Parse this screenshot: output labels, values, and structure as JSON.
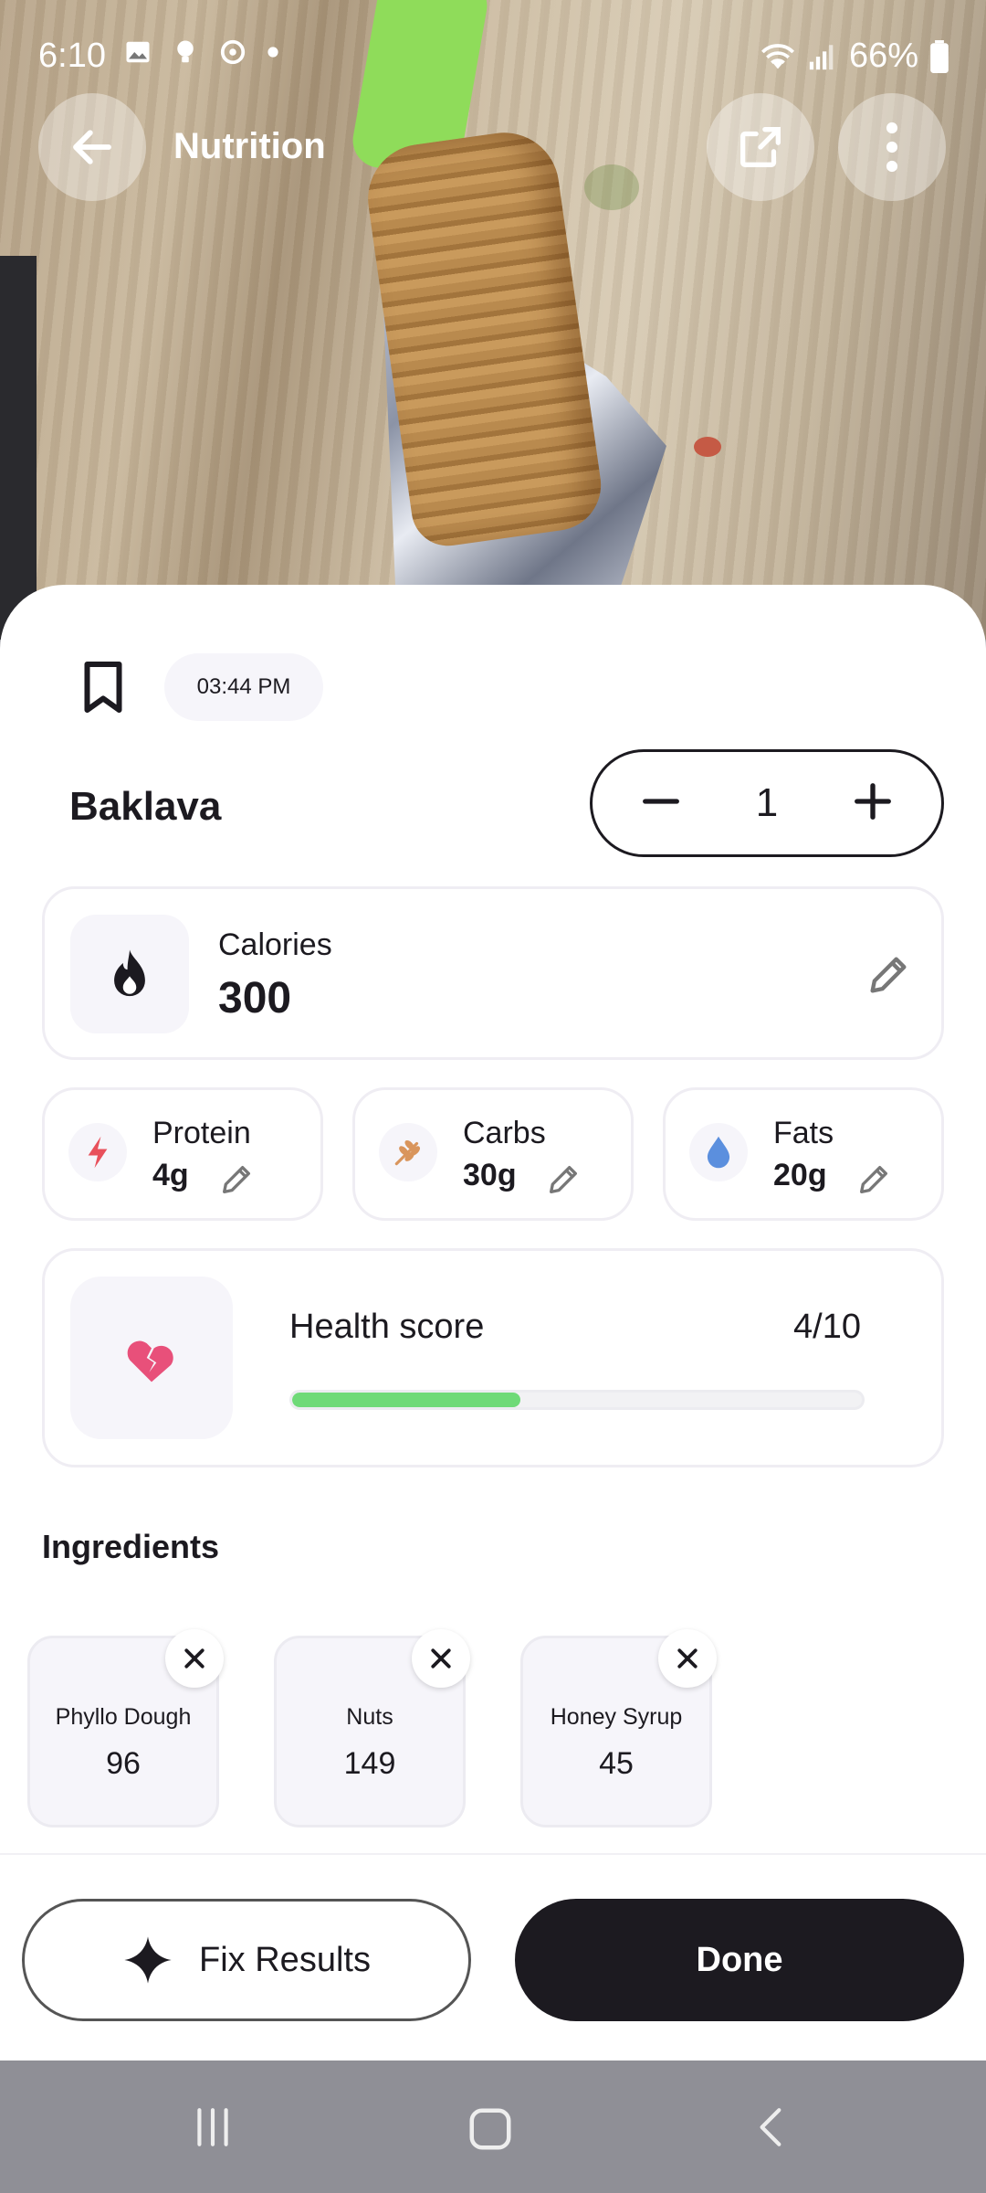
{
  "status_bar": {
    "time": "6:10",
    "battery": "66%"
  },
  "app_bar": {
    "title": "Nutrition"
  },
  "entry": {
    "timestamp": "03:44 PM",
    "food_name": "Baklava",
    "quantity": "1"
  },
  "calories": {
    "label": "Calories",
    "value": "300"
  },
  "macros": [
    {
      "label": "Protein",
      "value": "4g",
      "color": "#e8505b"
    },
    {
      "label": "Carbs",
      "value": "30g",
      "color": "#d9955c"
    },
    {
      "label": "Fats",
      "value": "20g",
      "color": "#5b8fde"
    }
  ],
  "health": {
    "label": "Health score",
    "score_text": "4/10",
    "score_fraction": 0.4,
    "bar_color": "#6fda78",
    "icon_color": "#e8507a"
  },
  "ingredients": {
    "title": "Ingredients",
    "items": [
      {
        "name": "Phyllo Dough",
        "calories": "96"
      },
      {
        "name": "Nuts",
        "calories": "149"
      },
      {
        "name": "Honey Syrup",
        "calories": "45"
      }
    ]
  },
  "actions": {
    "fix_label": "Fix Results",
    "done_label": "Done"
  }
}
